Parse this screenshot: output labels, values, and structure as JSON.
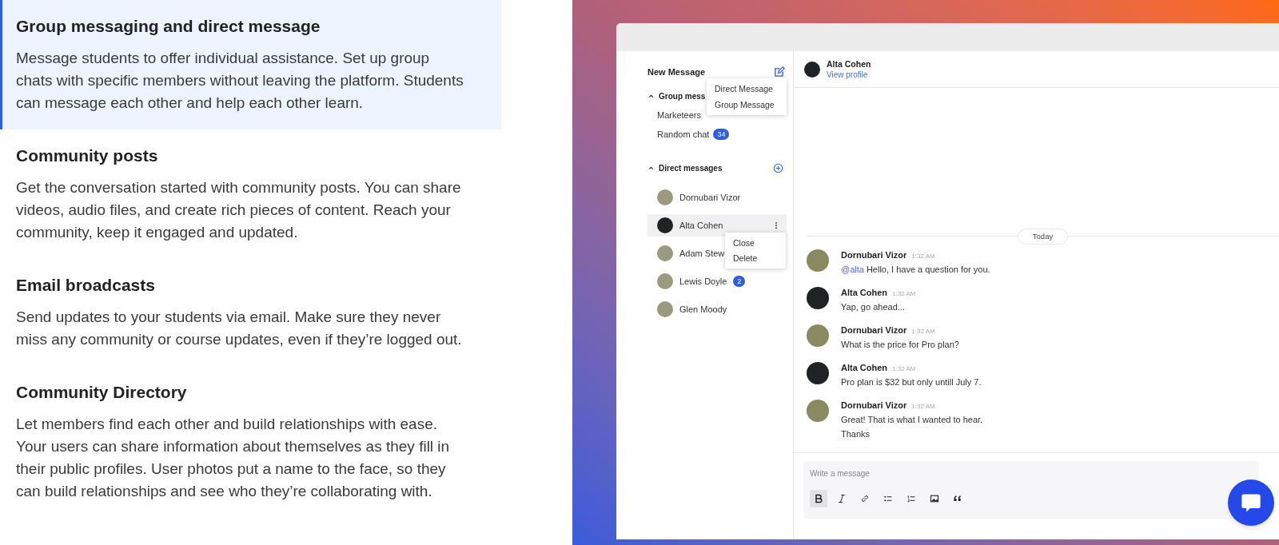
{
  "features": [
    {
      "title": "Group messaging and direct message",
      "text": "Message students to offer individual assistance. Set up group chats with specific members without leaving the platform. Students can message each other and help each other learn.",
      "selected": true
    },
    {
      "title": "Community posts",
      "text": "Get the conversation started with community posts. You can share videos, audio files, and create rich pieces of content. Reach your community, keep it engaged and updated.",
      "selected": false
    },
    {
      "title": "Email broadcasts",
      "text": "Send updates to your students via email. Make sure they never miss any community or course updates, even if they’re logged out.",
      "selected": false
    },
    {
      "title": "Community Directory",
      "text": "Let members find each other and build relationships with ease. Your users can share information about themselves as they fill in their public profiles. User photos put a name to the face, so they can build relationships and see who they’re collaborating with.",
      "selected": false
    }
  ],
  "app": {
    "sidebar": {
      "title": "New Message",
      "new_menu": [
        "Direct Message",
        "Group Message"
      ],
      "group_section": {
        "label": "Group mess",
        "expanded": true,
        "items": [
          {
            "name": "Marketeers"
          },
          {
            "name": "Random chat",
            "badge": "34"
          }
        ]
      },
      "direct_section": {
        "label": "Direct messages",
        "expanded": true,
        "items": [
          {
            "name": "Dornubari Vizor",
            "selected": false
          },
          {
            "name": "Alta Cohen",
            "selected": true
          },
          {
            "name": "Adam Stew",
            "selected": false
          },
          {
            "name": "Lewis Doyle",
            "badge": "2",
            "selected": false
          },
          {
            "name": "Glen Moody",
            "selected": false
          }
        ]
      },
      "context_menu": [
        "Close",
        "Delete"
      ]
    },
    "header": {
      "name": "Alta Cohen",
      "link": "View profile"
    },
    "day_divider": "Today",
    "messages": [
      {
        "author": "Dornubari Vizor",
        "time": "1:32 AM",
        "mention": "@alta",
        "lines": [
          "Hello, I have a question for you."
        ]
      },
      {
        "author": "Alta Cohen",
        "time": "1:32 AM",
        "lines": [
          "Yap, go ahead..."
        ]
      },
      {
        "author": "Dornubari Vizor",
        "time": "1:32 AM",
        "lines": [
          "What is the price for Pro plan?"
        ]
      },
      {
        "author": "Alta Cohen",
        "time": "1:32 AM",
        "lines": [
          "Pro plan is $32 but only untill July 7."
        ]
      },
      {
        "author": "Dornubari Vizor",
        "time": "1:32 AM",
        "lines": [
          "Great! That is what I wanted to hear.",
          "Thanks"
        ]
      }
    ],
    "composer": {
      "placeholder": "Write a message",
      "tools": [
        {
          "kind": "bold",
          "selected": true
        },
        {
          "kind": "italic",
          "selected": false
        },
        {
          "kind": "link",
          "selected": false
        },
        {
          "kind": "bullets",
          "selected": false
        },
        {
          "kind": "numbers",
          "selected": false
        },
        {
          "kind": "image",
          "selected": false
        },
        {
          "kind": "quote",
          "selected": false
        }
      ]
    }
  }
}
